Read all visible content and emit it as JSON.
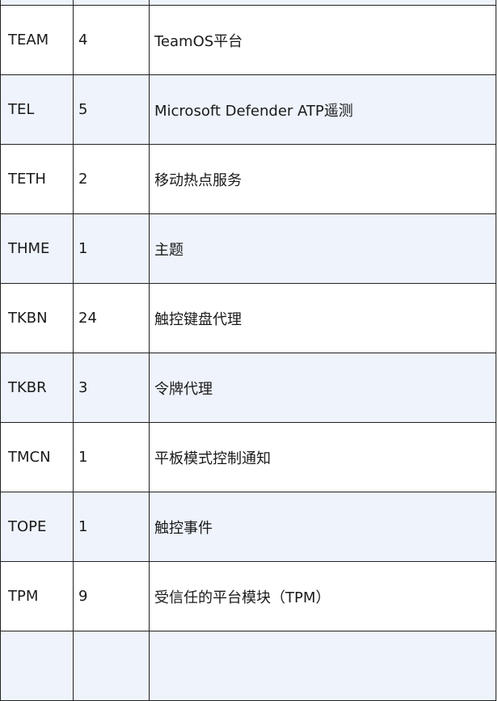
{
  "table": {
    "rows": [
      {
        "code": "TEAM",
        "count": "4",
        "description": "TeamOS平台"
      },
      {
        "code": "TEL",
        "count": "5",
        "description": "Microsoft Defender ATP遥测"
      },
      {
        "code": "TETH",
        "count": "2",
        "description": "移动热点服务"
      },
      {
        "code": "THME",
        "count": "1",
        "description": "主题"
      },
      {
        "code": "TKBN",
        "count": "24",
        "description": "触控键盘代理"
      },
      {
        "code": "TKBR",
        "count": "3",
        "description": "令牌代理"
      },
      {
        "code": "TMCN",
        "count": "1",
        "description": "平板模式控制通知"
      },
      {
        "code": "TOPE",
        "count": "1",
        "description": "触控事件"
      },
      {
        "code": "TPM",
        "count": "9",
        "description": "受信任的平台模块（TPM）"
      }
    ]
  }
}
